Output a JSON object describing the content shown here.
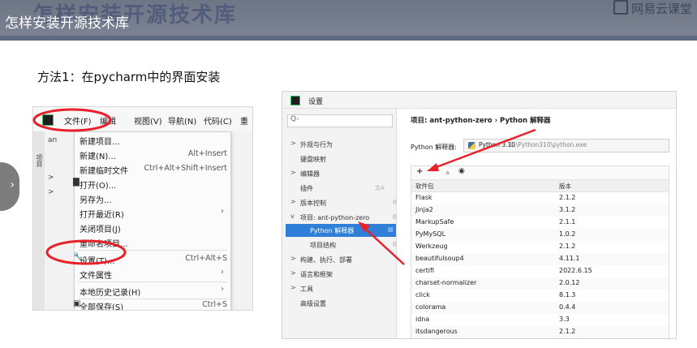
{
  "slide": {
    "watermark_title": "怎样安装开源技术库",
    "video_title": "怎样安装开源技术库",
    "brand": "网易云课堂",
    "method_title": "方法1：在pycharm中的界面安装"
  },
  "colors": {
    "annotation_red": "#e8202a",
    "selection_blue": "#2f7fd8",
    "header_gray": "#7a8191"
  },
  "left_screenshot": {
    "menubar": [
      "文件(F)",
      "编辑",
      "视图(V)",
      "导航(N)",
      "代码(C)",
      "重"
    ],
    "side_strip_label": "项目",
    "tree_rows": [
      "an",
      ">",
      ">"
    ],
    "file_menu": [
      {
        "label": "新建项目...",
        "shortcut": ""
      },
      {
        "label": "新建(N)...",
        "shortcut": "Alt+Insert"
      },
      {
        "label": "新建临时文件",
        "shortcut": "Ctrl+Alt+Shift+Insert"
      },
      {
        "label": "打开(O)...",
        "shortcut": "",
        "icon": "folder-icon"
      },
      {
        "label": "另存为...",
        "shortcut": ""
      },
      {
        "label": "打开最近(R)",
        "shortcut": "",
        "submenu": true
      },
      {
        "label": "关闭项目(J)",
        "shortcut": ""
      },
      {
        "label": "重命名项目...",
        "shortcut": ""
      },
      {
        "label": "设置(T)...",
        "shortcut": "Ctrl+Alt+S",
        "icon": "wrench-icon"
      },
      {
        "label": "文件属性",
        "shortcut": "",
        "submenu": true
      },
      {
        "label": "本地历史记录(H)",
        "shortcut": "",
        "submenu": true
      },
      {
        "label": "全部保存(S)",
        "shortcut": "Ctrl+S",
        "icon": "save-icon"
      }
    ]
  },
  "right_screenshot": {
    "window_title": "设置",
    "search_placeholder": "Q-",
    "sidebar": [
      {
        "label": "外观与行为",
        "chevron": ">"
      },
      {
        "label": "键盘映射",
        "chevron": ""
      },
      {
        "label": "编辑器",
        "chevron": ">"
      },
      {
        "label": "插件",
        "chevron": ""
      },
      {
        "label": "版本控制",
        "chevron": ">"
      },
      {
        "label": "项目: ant-python-zero",
        "chevron": "v"
      },
      {
        "label": "Python 解释器",
        "chevron": "",
        "selected": true
      },
      {
        "label": "项目结构",
        "chevron": ""
      },
      {
        "label": "构建、执行、部署",
        "chevron": ">"
      },
      {
        "label": "语言和框架",
        "chevron": ">"
      },
      {
        "label": "工具",
        "chevron": ">"
      },
      {
        "label": "高级设置",
        "chevron": ""
      }
    ],
    "breadcrumb": "项目: ant-python-zero  ›  Python 解释器",
    "interpreter_label": "Python 解释器:",
    "interpreter_version": "Python 3.10",
    "interpreter_path": "C:\\Python310\\python.exe",
    "toolbar": {
      "add": "+",
      "remove": "−",
      "up": "▲",
      "eye": "◉"
    },
    "columns": [
      "软件包",
      "版本"
    ],
    "packages": [
      {
        "name": "Flask",
        "version": "2.1.2"
      },
      {
        "name": "Jinja2",
        "version": "3.1.2"
      },
      {
        "name": "MarkupSafe",
        "version": "2.1.1"
      },
      {
        "name": "PyMySQL",
        "version": "1.0.2"
      },
      {
        "name": "Werkzeug",
        "version": "2.1.2"
      },
      {
        "name": "beautifulsoup4",
        "version": "4.11.1"
      },
      {
        "name": "certifi",
        "version": "2022.6.15"
      },
      {
        "name": "charset-normalizer",
        "version": "2.0.12"
      },
      {
        "name": "click",
        "version": "8.1.3"
      },
      {
        "name": "colorama",
        "version": "0.4.4"
      },
      {
        "name": "idna",
        "version": "3.3"
      },
      {
        "name": "itsdangerous",
        "version": "2.1.2"
      }
    ]
  }
}
